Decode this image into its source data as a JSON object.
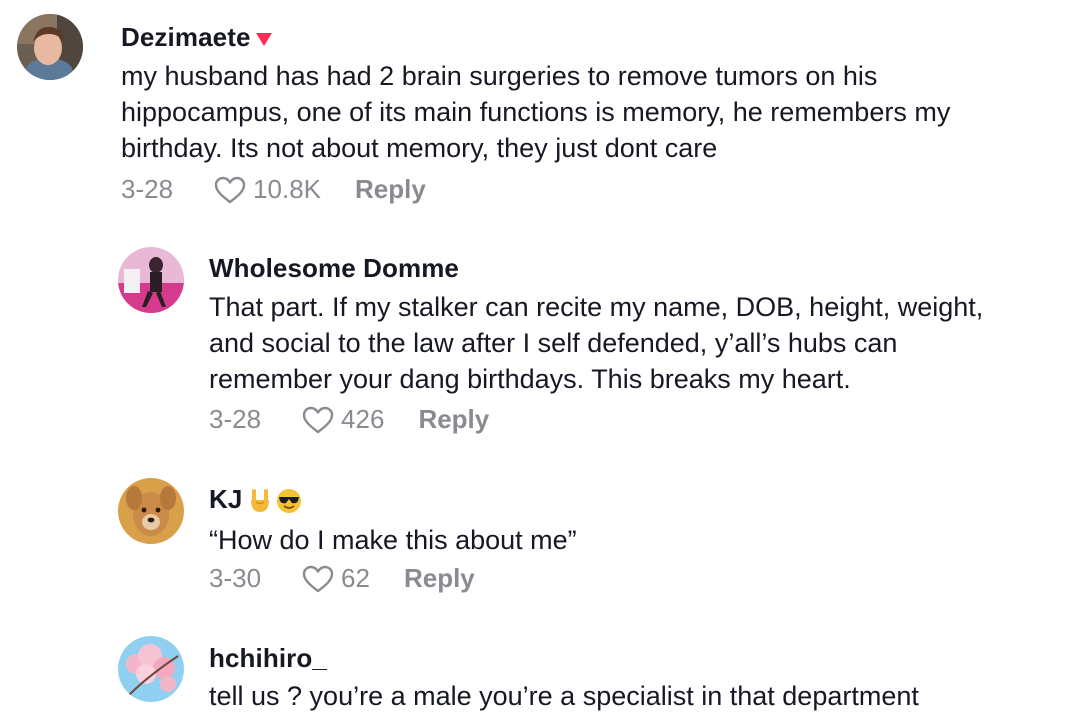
{
  "colors": {
    "text": "#161823",
    "secondary": "#8a8b91",
    "badge": "#fe2c55"
  },
  "comments": [
    {
      "username": "Dezimaete",
      "badge_icon": "red-triangle-icon",
      "lines": [
        "my husband has had 2 brain surgeries to remove tumors on his",
        "hippocampus, one of its main functions is memory, he remembers my",
        "birthday. Its not about memory, they just dont care"
      ],
      "date": "3-28",
      "likes": "10.8K",
      "reply_label": "Reply"
    },
    {
      "username": "Wholesome Domme",
      "lines": [
        "That part. If my stalker can recite my name, DOB, height, weight,",
        "and social to the law after I self defended, y’all’s hubs can",
        "remember your dang birthdays. This breaks my heart."
      ],
      "date": "3-28",
      "likes": "426",
      "reply_label": "Reply"
    },
    {
      "username": "KJ",
      "username_emojis": [
        "rock-on-hand-emoji",
        "sunglasses-face-emoji"
      ],
      "lines": [
        "“How do I make this about me”"
      ],
      "date": "3-30",
      "likes": "62",
      "reply_label": "Reply"
    },
    {
      "username": "hchihiro_",
      "lines": [
        "tell us ? you’re a male you’re a specialist in that department"
      ]
    }
  ]
}
